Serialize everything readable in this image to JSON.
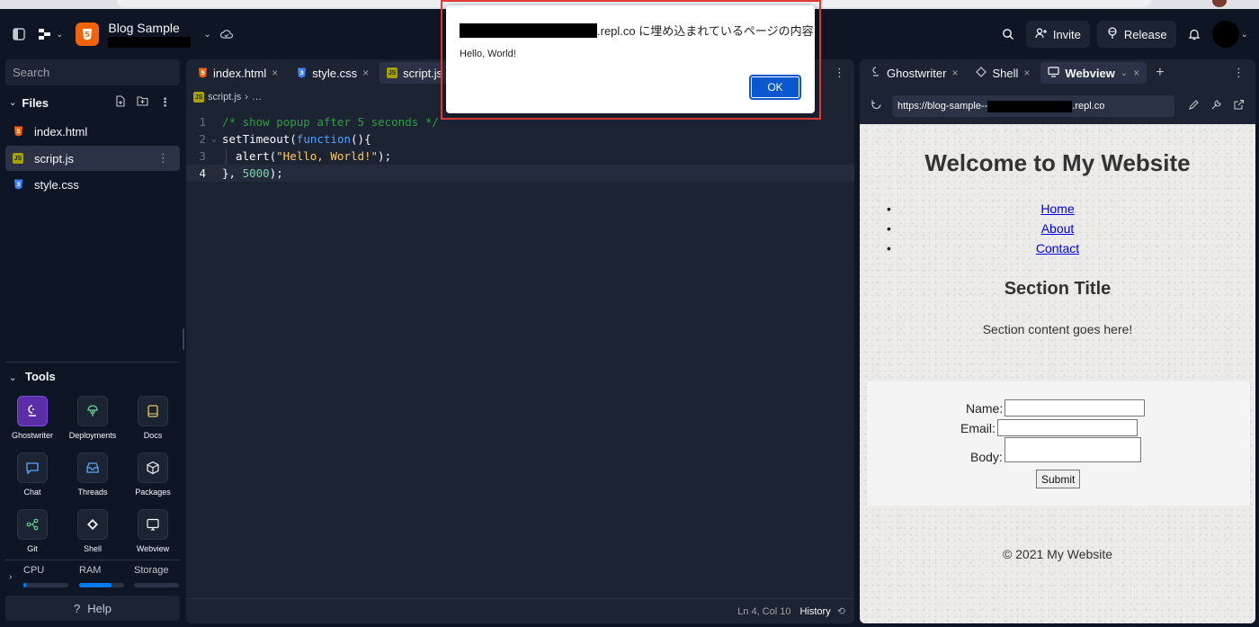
{
  "topbar": {
    "repl_name": "Blog Sample",
    "invite_label": "Invite",
    "release_label": "Release"
  },
  "sidebar": {
    "search_placeholder": "Search",
    "files_header": "Files",
    "files": [
      {
        "name": "index.html",
        "type": "html"
      },
      {
        "name": "script.js",
        "type": "js",
        "active": true
      },
      {
        "name": "style.css",
        "type": "css"
      }
    ],
    "tools_header": "Tools",
    "tools": [
      {
        "label": "Ghostwriter",
        "icon": "ghostwriter-icon"
      },
      {
        "label": "Deployments",
        "icon": "deployments-icon"
      },
      {
        "label": "Docs",
        "icon": "docs-icon"
      },
      {
        "label": "Chat",
        "icon": "chat-icon"
      },
      {
        "label": "Threads",
        "icon": "threads-icon"
      },
      {
        "label": "Packages",
        "icon": "packages-icon"
      },
      {
        "label": "Git",
        "icon": "git-icon"
      },
      {
        "label": "Shell",
        "icon": "shell-icon"
      },
      {
        "label": "Webview",
        "icon": "webview-icon"
      }
    ],
    "resources": {
      "cpu_label": "CPU",
      "ram_label": "RAM",
      "storage_label": "Storage",
      "cpu_usage": 0.05,
      "ram_usage": 0.72,
      "storage_usage": 0.0
    },
    "help_label": "Help"
  },
  "editor": {
    "tabs": [
      {
        "label": "index.html",
        "type": "html"
      },
      {
        "label": "style.css",
        "type": "css"
      },
      {
        "label": "script.js",
        "type": "js",
        "active": true
      }
    ],
    "breadcrumb": {
      "file": "script.js",
      "trail": "…"
    },
    "lines": {
      "l1_num": "1",
      "l1": "/* show popup after 5 seconds */",
      "l2_num": "2",
      "l2_fn": "setTimeout",
      "l2_open": "(",
      "l2_kw": "function",
      "l2_rest": "(){",
      "l3_num": "3",
      "l3_fn": "alert(",
      "l3_str": "\"Hello, World!\"",
      "l3_rest": ");",
      "l4_num": "4",
      "l4_pre": "}, ",
      "l4_num_val": "5000",
      "l4_rest": ");"
    },
    "status": {
      "position": "Ln 4, Col 10",
      "history_label": "History"
    }
  },
  "rpanel": {
    "tabs": [
      {
        "label": "Ghostwriter",
        "icon": "ghostwriter-icon"
      },
      {
        "label": "Shell",
        "icon": "shell-icon"
      },
      {
        "label": "Webview",
        "icon": "webview-icon",
        "active": true
      }
    ],
    "url_prefix": "https://blog-sample--",
    "url_suffix": ".repl.co"
  },
  "webview": {
    "title": "Welcome to My Website",
    "nav": [
      "Home",
      "About",
      "Contact"
    ],
    "section_title": "Section Title",
    "section_content": "Section content goes here!",
    "form": {
      "name_label": "Name:",
      "email_label": "Email:",
      "body_label": "Body:",
      "submit_label": "Submit"
    },
    "footer": "© 2021 My Website"
  },
  "dialog": {
    "origin_suffix": ".repl.co に埋め込まれているページの内容",
    "message": "Hello, World!",
    "ok_label": "OK"
  },
  "colors": {
    "background": "#0e1525",
    "panel": "#1c2333",
    "accent_blue": "#0079f2",
    "dialog_highlight": "#e53935"
  }
}
